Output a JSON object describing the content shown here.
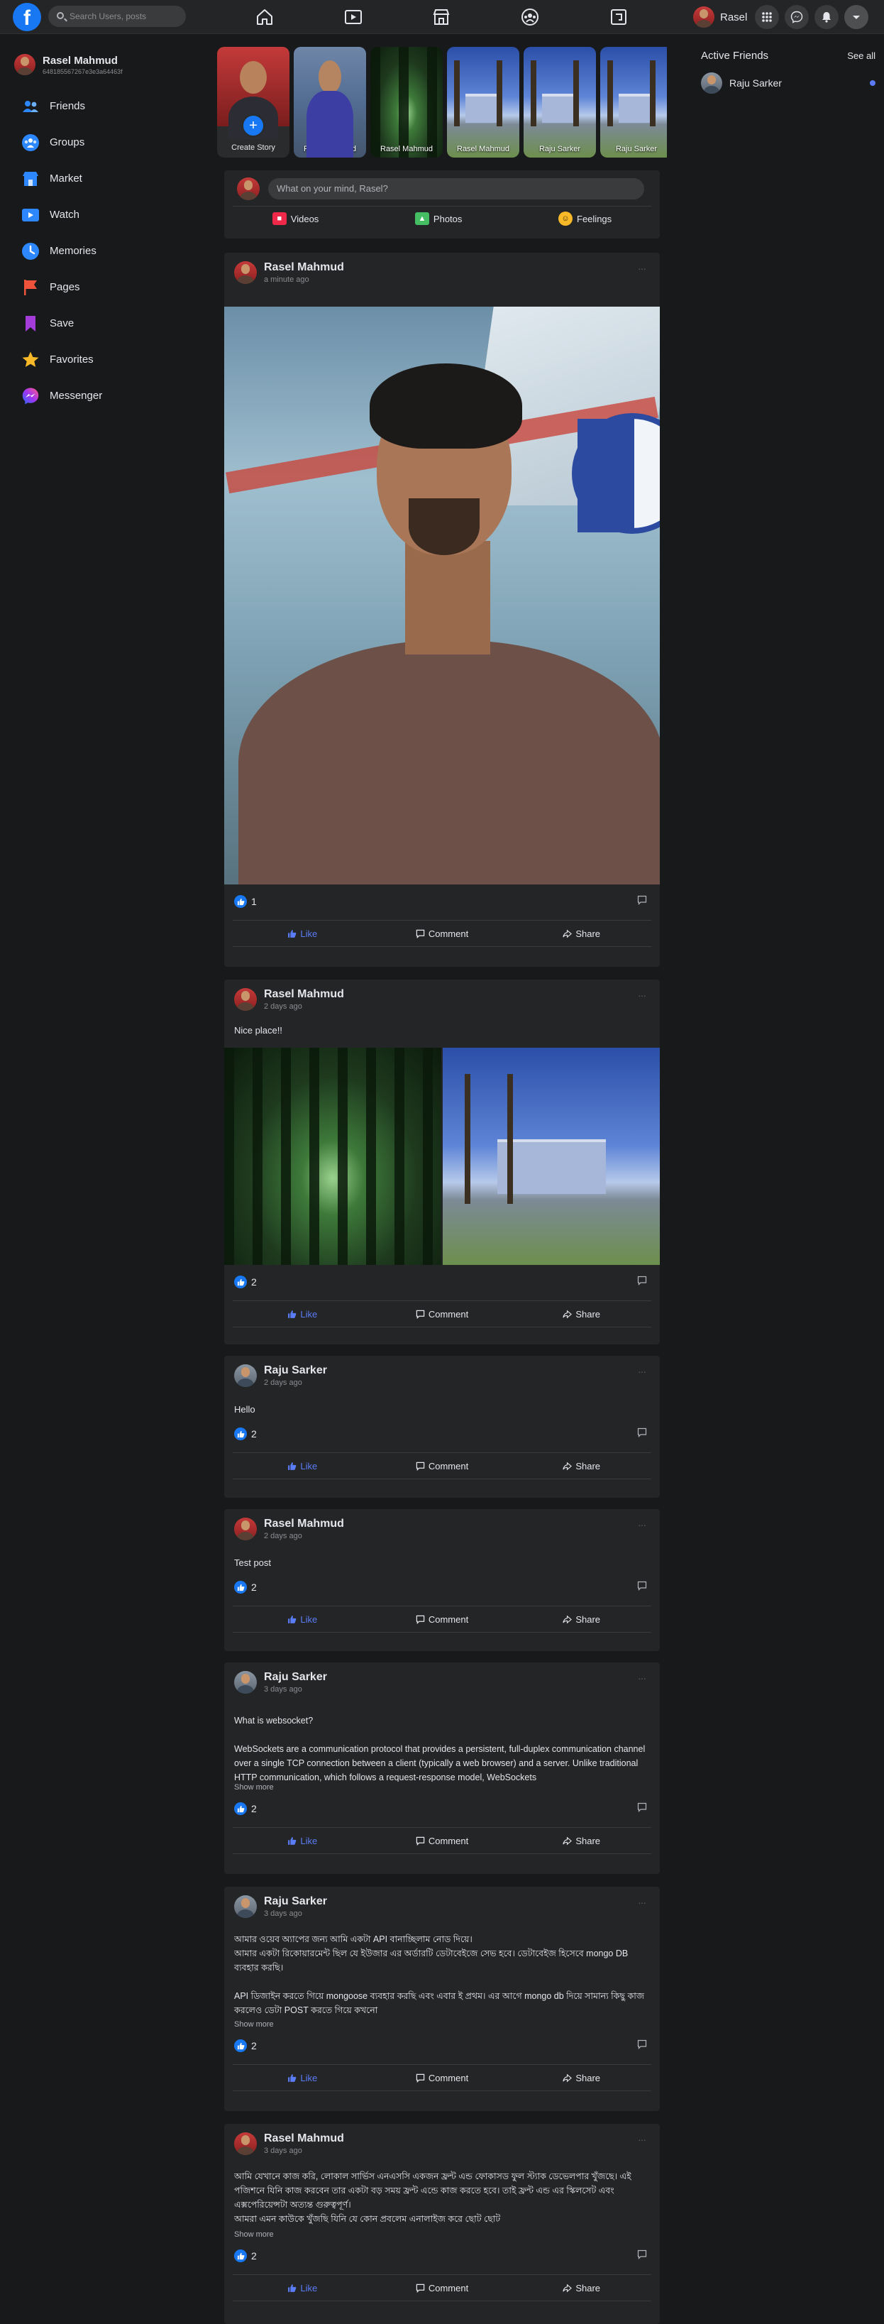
{
  "nav": {
    "search_placeholder": "Search Users, posts",
    "user_name": "Rasel"
  },
  "sidebar": {
    "profile_name": "Rasel Mahmud",
    "profile_id": "648185567267e3e3a64463f",
    "items": [
      {
        "label": "Friends",
        "icon": "friends-icon",
        "color": "#2d88ff"
      },
      {
        "label": "Groups",
        "icon": "groups-icon",
        "color": "#2d88ff"
      },
      {
        "label": "Market",
        "icon": "market-icon",
        "color": "#2d88ff"
      },
      {
        "label": "Watch",
        "icon": "watch-icon",
        "color": "#2d88ff"
      },
      {
        "label": "Memories",
        "icon": "memories-icon",
        "color": "#2d88ff"
      },
      {
        "label": "Pages",
        "icon": "pages-icon",
        "color": "#f0533c"
      },
      {
        "label": "Save",
        "icon": "save-icon",
        "color": "#a33cd8"
      },
      {
        "label": "Favorites",
        "icon": "favorites-icon",
        "color": "#f7b928"
      },
      {
        "label": "Messenger",
        "icon": "messenger-icon",
        "color": "#a034f0"
      }
    ]
  },
  "stories": [
    {
      "label": "Create Story"
    },
    {
      "label": "Rasel Mahmud"
    },
    {
      "label": "Rasel Mahmud"
    },
    {
      "label": "Rasel Mahmud"
    },
    {
      "label": "Raju Sarker"
    },
    {
      "label": "Raju Sarker"
    }
  ],
  "composer": {
    "placeholder": "What on your mind, Rasel?",
    "videos": "Videos",
    "photos": "Photos",
    "feelings": "Feelings"
  },
  "rightbar": {
    "title": "Active Friends",
    "see_all": "See all",
    "friends": [
      {
        "name": "Raju Sarker"
      }
    ]
  },
  "actions": {
    "like": "Like",
    "comment": "Comment",
    "share": "Share",
    "show_more": "Show more"
  },
  "posts": [
    {
      "author": "Rasel Mahmud",
      "time": "a minute ago",
      "text": "",
      "likes": "1"
    },
    {
      "author": "Rasel Mahmud",
      "time": "2 days ago",
      "text": "Nice place!!",
      "likes": "2"
    },
    {
      "author": "Raju Sarker",
      "time": "2 days ago",
      "text": "Hello",
      "likes": "2"
    },
    {
      "author": "Rasel Mahmud",
      "time": "2 days ago",
      "text": "Test post",
      "likes": "2"
    },
    {
      "author": "Raju Sarker",
      "time": "3 days ago",
      "text": "What is websocket?\n\nWebSockets are a communication protocol that provides a persistent, full-duplex communication channel over a single TCP connection between a client (typically a web browser) and a server. Unlike traditional HTTP communication, which follows a request-response model, WebSockets",
      "likes": "2"
    },
    {
      "author": "Raju Sarker",
      "time": "3 days ago",
      "text": "আমার ওয়েব অ্যাপের জন্য আমি একটা API বানাচ্ছিলাম নোড দিয়ে।\nআমার একটা রিকোয়ারমেন্ট ছিল যে ইউজার এর অর্ডারটি ডেটাবেইজে সেভ হবে। ডেটাবেইজ হিসেবে mongo DB ব্যবহার করছি।\n\nAPI ডিজাইন করতে গিয়ে mongoose ব্যবহার করছি এবং এবার ই প্রথম। এর আগে mongo db দিয়ে সামান্য কিছু কাজ করলেও ডেটা POST করতে গিয়ে কখনো",
      "likes": "2"
    },
    {
      "author": "Rasel Mahmud",
      "time": "3 days ago",
      "text": "আমি যেখানে কাজ করি, লোকাল সার্ভিস এনএসসি একজন ফ্রন্ট এন্ড ফোকাসড ফুল স্ট্যাক ডেভেলপার খুঁজছে। এই পজিশনে যিনি কাজ করবেন তার একটা বড় সময় ফ্রন্ট এন্ডে কাজ করতে হবে। তাই ফ্রন্ট এন্ড এর স্কিলসেট এবং এক্সপেরিয়েন্সটা অত্যন্ত গুরুত্বপূর্ণ।\nআমরা এমন কাউকে খুঁজছি যিনি যে কোন প্রবলেম এনালাইজ করে ছোট ছোট",
      "likes": "2"
    }
  ]
}
